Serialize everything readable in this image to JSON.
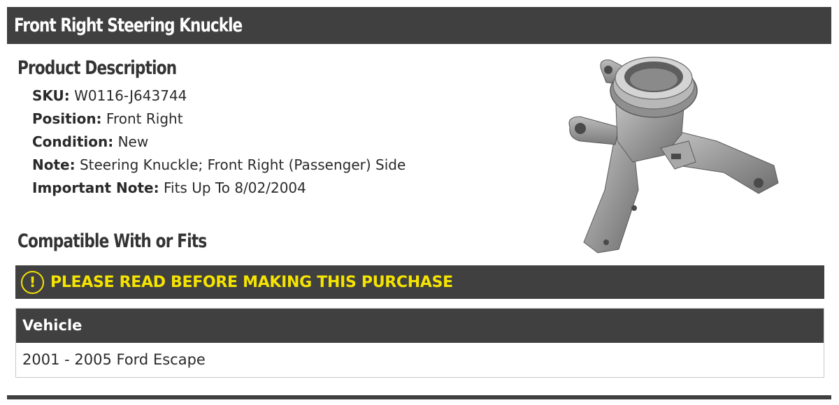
{
  "page": {
    "title": "Front Right Steering Knuckle"
  },
  "description": {
    "heading": "Product Description",
    "specs": [
      {
        "key": "SKU:",
        "value": "W0116-J643744"
      },
      {
        "key": "Position:",
        "value": "Front Right"
      },
      {
        "key": "Condition:",
        "value": "New"
      },
      {
        "key": "Note:",
        "value": "Steering Knuckle; Front Right (Passenger) Side"
      },
      {
        "key": "Important Note:",
        "value": "Fits Up To 8/02/2004"
      }
    ]
  },
  "compatibility": {
    "heading": "Compatible With or Fits",
    "warning_icon": "exclamation-circle-icon",
    "warning_icon_glyph": "!",
    "warning": "PLEASE READ BEFORE MAKING THIS PURCHASE",
    "table": {
      "columns": [
        "Vehicle"
      ],
      "rows": [
        [
          "2001 - 2005 Ford Escape"
        ]
      ]
    }
  },
  "colors": {
    "header_bg": "#404040",
    "warning_text": "#f5e400",
    "header_text": "#ffffff"
  }
}
